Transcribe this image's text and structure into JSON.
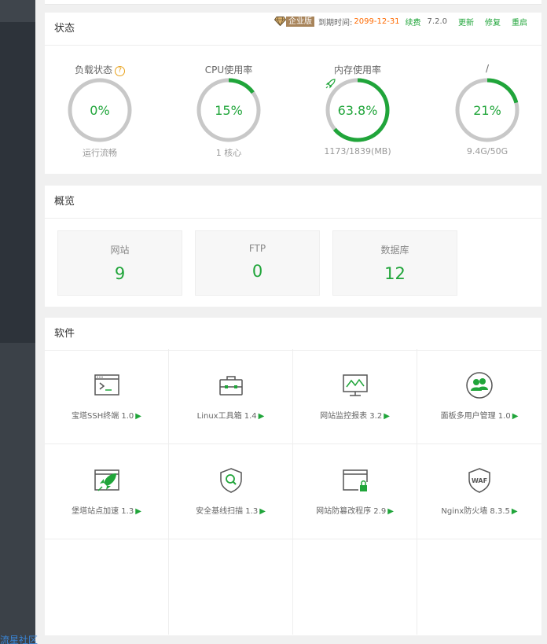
{
  "footer": {
    "link": "流星社区"
  },
  "status": {
    "heading": "状态",
    "version_bar": {
      "edition": "企业版",
      "expire_label": "到期时间:",
      "expire_date": "2099-12-31",
      "renew": "续费",
      "version": "7.2.0",
      "update": "更新",
      "repair": "修复",
      "restart": "重启"
    },
    "gauges": [
      {
        "title": "负载状态",
        "value": "0%",
        "percent": 0,
        "sub": "运行流畅",
        "help": "?"
      },
      {
        "title": "CPU使用率",
        "value": "15%",
        "percent": 15,
        "sub": "1 核心"
      },
      {
        "title": "内存使用率",
        "value": "63.8%",
        "percent": 63.8,
        "sub": "1173/1839(MB)"
      },
      {
        "title": "/",
        "value": "21%",
        "percent": 21,
        "sub": "9.4G/50G"
      }
    ]
  },
  "overview": {
    "heading": "概览",
    "cards": [
      {
        "label": "网站",
        "value": "9"
      },
      {
        "label": "FTP",
        "value": "0"
      },
      {
        "label": "数据库",
        "value": "12"
      }
    ]
  },
  "software": {
    "heading": "软件",
    "items": [
      {
        "name": "宝塔SSH终端 1.0",
        "icon": "terminal-icon"
      },
      {
        "name": "Linux工具箱 1.4",
        "icon": "toolbox-icon"
      },
      {
        "name": "网站监控报表 3.2",
        "icon": "monitor-chart-icon"
      },
      {
        "name": "面板多用户管理 1.0",
        "icon": "multi-user-icon"
      },
      {
        "name": "堡塔站点加速 1.3",
        "icon": "rocket-icon"
      },
      {
        "name": "安全基线扫描 1.3",
        "icon": "shield-scan-icon"
      },
      {
        "name": "网站防篡改程序 2.9",
        "icon": "lock-window-icon"
      },
      {
        "name": "Nginx防火墙 8.3.5",
        "icon": "waf-shield-icon"
      }
    ],
    "arrow": "▶"
  },
  "colors": {
    "accent": "#20a53a",
    "expire": "#ff6a00",
    "sidebar": "#2d333a"
  }
}
